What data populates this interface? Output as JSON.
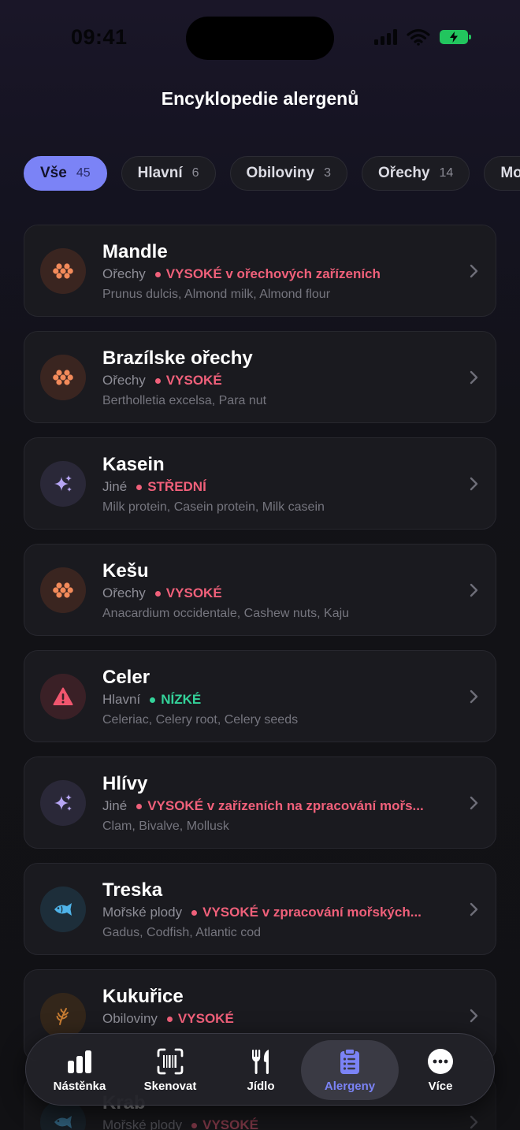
{
  "status": {
    "time": "09:41"
  },
  "title": "Encyklopedie alergenů",
  "filters": [
    {
      "label": "Vše",
      "count": "45",
      "active": true
    },
    {
      "label": "Hlavní",
      "count": "6"
    },
    {
      "label": "Obiloviny",
      "count": "3"
    },
    {
      "label": "Ořechy",
      "count": "14"
    },
    {
      "label": "Mo",
      "count": ""
    }
  ],
  "items": [
    {
      "name": "Mandle",
      "category": "Ořechy",
      "risk": "VYSOKÉ v ořechových zařízeních",
      "aliases": "Prunus dulcis, Almond milk, Almond flour",
      "icon": "nut-cluster-icon"
    },
    {
      "name": "Brazílske ořechy",
      "category": "Ořechy",
      "risk": "VYSOKÉ",
      "aliases": "Bertholletia excelsa, Para nut",
      "icon": "nut-cluster-icon"
    },
    {
      "name": "Kasein",
      "category": "Jiné",
      "risk": "STŘEDNÍ",
      "aliases": "Milk protein, Casein protein, Milk casein",
      "icon": "sparkles-icon"
    },
    {
      "name": "Kešu",
      "category": "Ořechy",
      "risk": "VYSOKÉ",
      "aliases": "Anacardium occidentale, Cashew nuts, Kaju",
      "icon": "nut-cluster-icon"
    },
    {
      "name": "Celer",
      "category": "Hlavní",
      "risk": "NÍZKÉ",
      "aliases": "Celeriac, Celery root, Celery seeds",
      "icon": "warning-icon"
    },
    {
      "name": "Hlívy",
      "category": "Jiné",
      "risk": "VYSOKÉ v zařízeních na zpracování mořs...",
      "aliases": "Clam, Bivalve, Mollusk",
      "icon": "sparkles-icon"
    },
    {
      "name": "Treska",
      "category": "Mořské plody",
      "risk": "VYSOKÉ v zpracování mořských...",
      "aliases": "Gadus, Codfish, Atlantic cod",
      "icon": "fish-icon"
    },
    {
      "name": "Kukuřice",
      "category": "Obiloviny",
      "risk": "VYSOKÉ",
      "aliases": "",
      "icon": "wheat-icon"
    },
    {
      "name": "Krab",
      "category": "Mořské plody",
      "risk": "VYSOKÉ",
      "aliases": "",
      "icon": "fish-icon"
    }
  ],
  "tabs": [
    {
      "label": "Nástěnka",
      "icon": "bar-chart-icon"
    },
    {
      "label": "Skenovat",
      "icon": "barcode-scan-icon"
    },
    {
      "label": "Jídlo",
      "icon": "fork-knife-icon"
    },
    {
      "label": "Alergeny",
      "icon": "clipboard-list-icon",
      "active": true
    },
    {
      "label": "Více",
      "icon": "more-icon"
    }
  ],
  "colors": {
    "accent": "#7b83f6",
    "risk_high": "#f0607a",
    "risk_medium": "#f0607a",
    "risk_low": "#34d39a",
    "nut": "#f28a5a",
    "sparkle": "#b7a6f5",
    "warning": "#f0566e",
    "fish": "#4fb3e8",
    "wheat": "#c77c32"
  }
}
